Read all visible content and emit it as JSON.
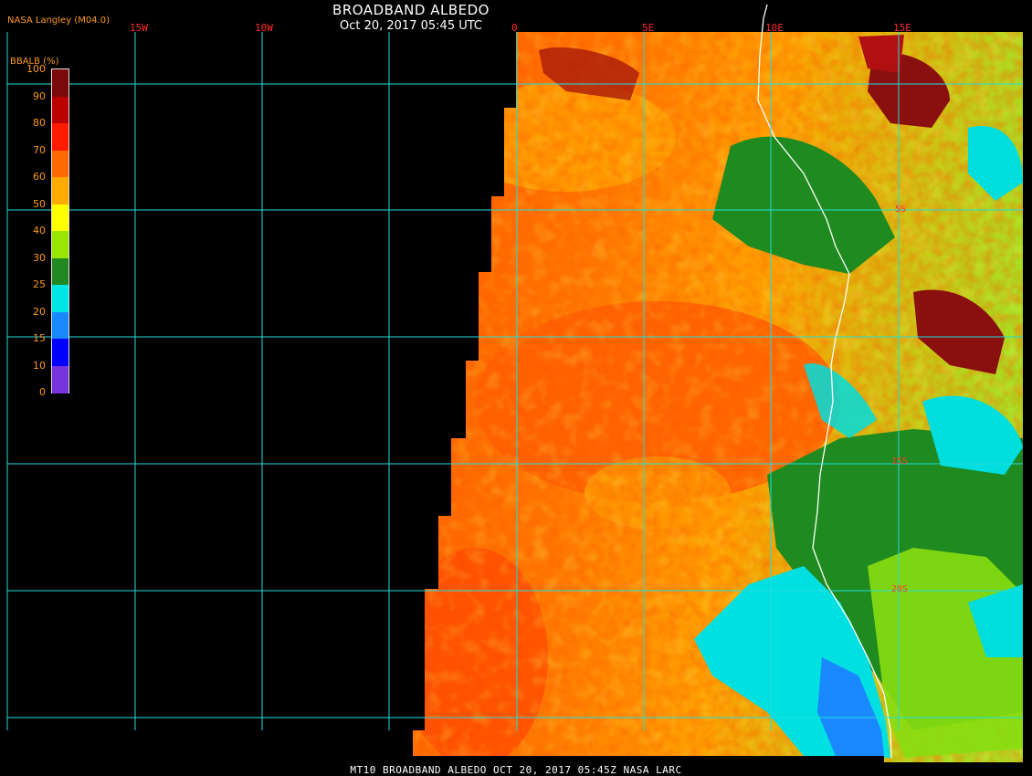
{
  "header": {
    "title": "BROADBAND ALBEDO",
    "subtitle": "Oct 20, 2017 05:45 UTC",
    "producer": "NASA Langley (M04.0)"
  },
  "legend": {
    "label": "BBALB (%)",
    "ticks": [
      "100",
      "90",
      "80",
      "70",
      "60",
      "50",
      "40",
      "30",
      "25",
      "20",
      "15",
      "10",
      "0"
    ],
    "colors": [
      "#7a0a0a",
      "#bb0000",
      "#ff1a00",
      "#ff6a00",
      "#ffaa00",
      "#ffff00",
      "#99e600",
      "#228822",
      "#00e6e6",
      "#1a88ff",
      "#0000ff",
      "#7733dd"
    ]
  },
  "map": {
    "lon_labels": [
      "15W",
      "10W",
      "0",
      "5E",
      "10E",
      "15E"
    ],
    "lat_labels": [
      "5S",
      "15S",
      "20S"
    ],
    "grid_color": "#22dddd",
    "coast_color": "#ffffff"
  },
  "footer": {
    "text": "MT10  BROADBAND ALBEDO   OCT 20, 2017 05:45Z   NASA LARC"
  }
}
